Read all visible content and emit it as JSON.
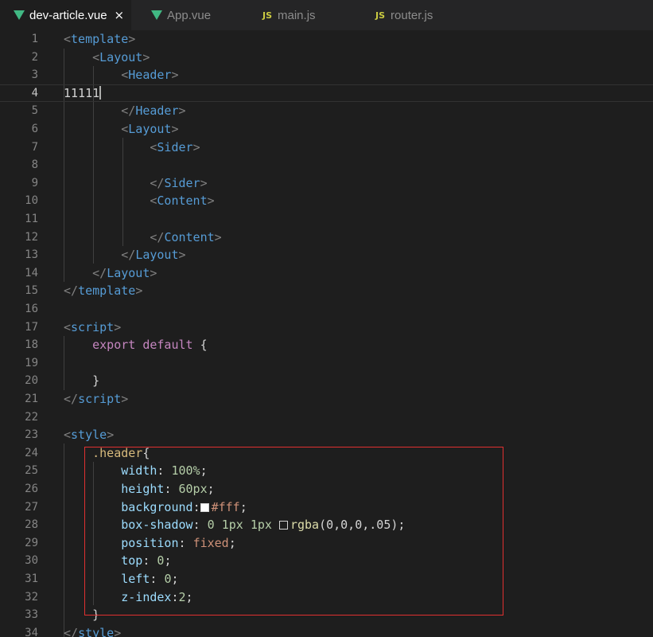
{
  "tabs": [
    {
      "label": "dev-article.vue",
      "icon": "vue-icon",
      "active": true,
      "close": "×"
    },
    {
      "label": "App.vue",
      "icon": "vue-icon",
      "active": false
    },
    {
      "label": "main.js",
      "icon": "js-icon",
      "icon_text": "JS",
      "active": false
    },
    {
      "label": "router.js",
      "icon": "js-icon",
      "icon_text": "JS",
      "active": false
    }
  ],
  "lines": {
    "1": "1",
    "2": "2",
    "3": "3",
    "4": "4",
    "5": "5",
    "6": "6",
    "7": "7",
    "8": "8",
    "9": "9",
    "10": "10",
    "11": "11",
    "12": "12",
    "13": "13",
    "14": "14",
    "15": "15",
    "16": "16",
    "17": "17",
    "18": "18",
    "19": "19",
    "20": "20",
    "21": "21",
    "22": "22",
    "23": "23",
    "24": "24",
    "25": "25",
    "26": "26",
    "27": "27",
    "28": "28",
    "29": "29",
    "30": "30",
    "31": "31",
    "32": "32",
    "33": "33",
    "34": "34"
  },
  "code": {
    "template": "template",
    "Layout": "Layout",
    "Header": "Header",
    "typed": "11111",
    "Sider": "Sider",
    "Content": "Content",
    "script": "script",
    "export": "export",
    "default": "default",
    "style": "style",
    "selector": ".header",
    "width_prop": "width",
    "width_val": "100%",
    "height_prop": "height",
    "height_val": "60px",
    "background_prop": "background",
    "background_val": "#fff",
    "shadow_prop": "box-shadow",
    "shadow_zero": "0",
    "shadow_1px_a": "1px",
    "shadow_1px_b": "1px",
    "shadow_rgba": "rgba",
    "shadow_args": "(0,0,0,.05)",
    "position_prop": "position",
    "position_val": "fixed",
    "top_prop": "top",
    "top_val": "0",
    "left_prop": "left",
    "left_val": "0",
    "zindex_prop": "z-index",
    "zindex_val": "2"
  },
  "colors": {
    "highlight_box": "#e03030",
    "vue_icon": "#41b883",
    "js_icon": "#cbcb41"
  }
}
